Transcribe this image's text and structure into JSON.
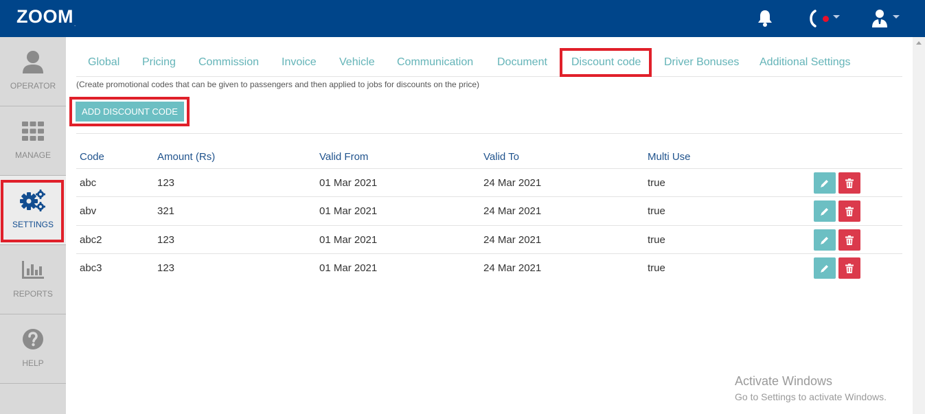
{
  "app": {
    "logo": "ZOOM",
    "logo_mark": "."
  },
  "header_icons": [
    "bell-icon",
    "phone-icon",
    "user-icon"
  ],
  "sidebar": {
    "items": [
      {
        "label": "OPERATOR",
        "icon": "operator-icon"
      },
      {
        "label": "MANAGE",
        "icon": "grid-icon"
      },
      {
        "label": "SETTINGS",
        "icon": "gears-icon",
        "active": true
      },
      {
        "label": "REPORTS",
        "icon": "bar-chart-icon"
      },
      {
        "label": "HELP",
        "icon": "question-icon"
      }
    ]
  },
  "tabs": [
    {
      "label": "Global"
    },
    {
      "label": "Pricing"
    },
    {
      "label": "Commission"
    },
    {
      "label": "Invoice"
    },
    {
      "label": "Vehicle"
    },
    {
      "label": "Communication"
    },
    {
      "label": "Document"
    },
    {
      "label": "Discount code",
      "active": true
    },
    {
      "label": "Driver Bonuses"
    },
    {
      "label": "Additional Settings"
    }
  ],
  "description": "(Create promotional codes that can be given to passengers and then applied to jobs for discounts on the price)",
  "add_button_label": "ADD DISCOUNT CODE",
  "table": {
    "headers": [
      "Code",
      "Amount (Rs)",
      "Valid From",
      "Valid To",
      "Multi Use"
    ],
    "rows": [
      [
        "abc",
        "123",
        "01 Mar 2021",
        "24 Mar 2021",
        "true"
      ],
      [
        "abv",
        "321",
        "01 Mar 2021",
        "24 Mar 2021",
        "true"
      ],
      [
        "abc2",
        "123",
        "01 Mar 2021",
        "24 Mar 2021",
        "true"
      ],
      [
        "abc3",
        "123",
        "01 Mar 2021",
        "24 Mar 2021",
        "true"
      ]
    ]
  },
  "watermark": {
    "line1": "Activate Windows",
    "line2": "Go to Settings to activate Windows."
  },
  "colors": {
    "header": "#00458a",
    "accent": "#6cbfc3",
    "danger": "#db3a4c",
    "highlight": "#e0202a"
  }
}
